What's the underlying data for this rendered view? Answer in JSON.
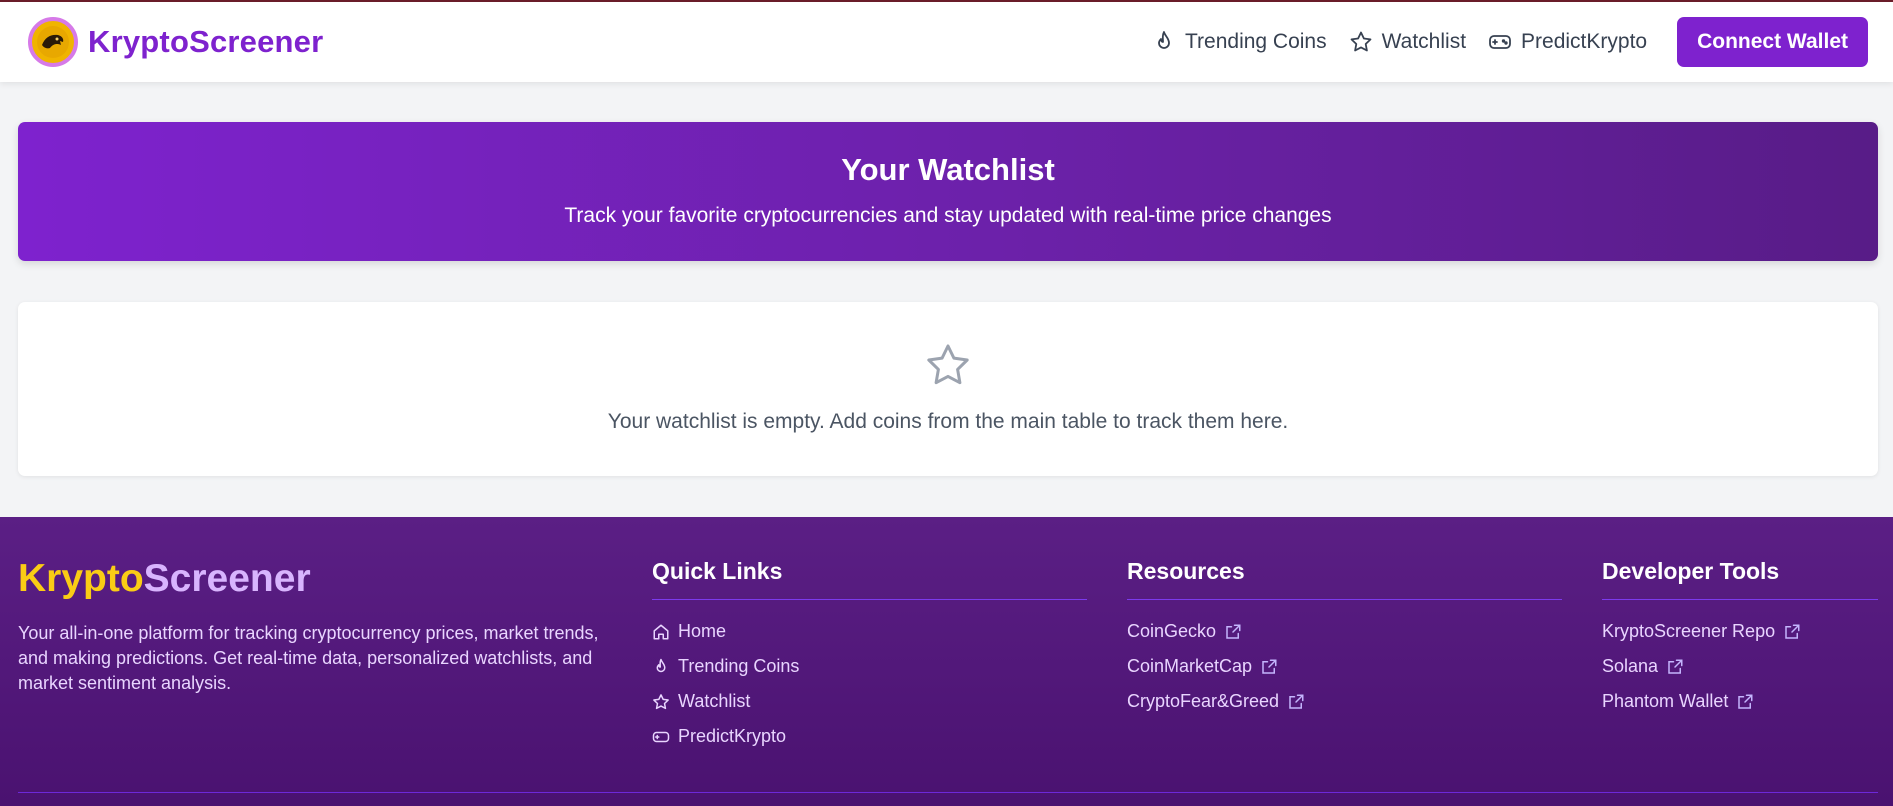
{
  "header": {
    "brand": "KryptoScreener",
    "nav": [
      {
        "label": "Trending Coins",
        "icon": "flame-icon"
      },
      {
        "label": "Watchlist",
        "icon": "star-icon"
      },
      {
        "label": "PredictKrypto",
        "icon": "gamepad-icon"
      }
    ],
    "connect_label": "Connect Wallet"
  },
  "hero": {
    "title": "Your Watchlist",
    "subtitle": "Track your favorite cryptocurrencies and stay updated with real-time price changes"
  },
  "empty_state": {
    "icon": "star-outline-icon",
    "message": "Your watchlist is empty. Add coins from the main table to track them here."
  },
  "footer": {
    "brand_part1": "Krypto",
    "brand_part2": "Screener",
    "description": "Your all-in-one platform for tracking cryptocurrency prices, market trends, and making predictions. Get real-time data, personalized watchlists, and market sentiment analysis.",
    "quick_links": {
      "title": "Quick Links",
      "items": [
        {
          "label": "Home",
          "icon": "home-icon"
        },
        {
          "label": "Trending Coins",
          "icon": "flame-icon"
        },
        {
          "label": "Watchlist",
          "icon": "star-icon"
        },
        {
          "label": "PredictKrypto",
          "icon": "gamepad-icon"
        }
      ]
    },
    "resources": {
      "title": "Resources",
      "items": [
        {
          "label": "CoinGecko"
        },
        {
          "label": "CoinMarketCap"
        },
        {
          "label": "CryptoFear&Greed"
        }
      ]
    },
    "developer_tools": {
      "title": "Developer Tools",
      "items": [
        {
          "label": "KryptoScreener Repo"
        },
        {
          "label": "Solana"
        },
        {
          "label": "Phantom Wallet"
        }
      ]
    }
  },
  "colors": {
    "brand_purple": "#7e22ce",
    "footer_bg": "#4a1270",
    "accent_yellow": "#facc15",
    "light_purple": "#d8b4fe"
  }
}
